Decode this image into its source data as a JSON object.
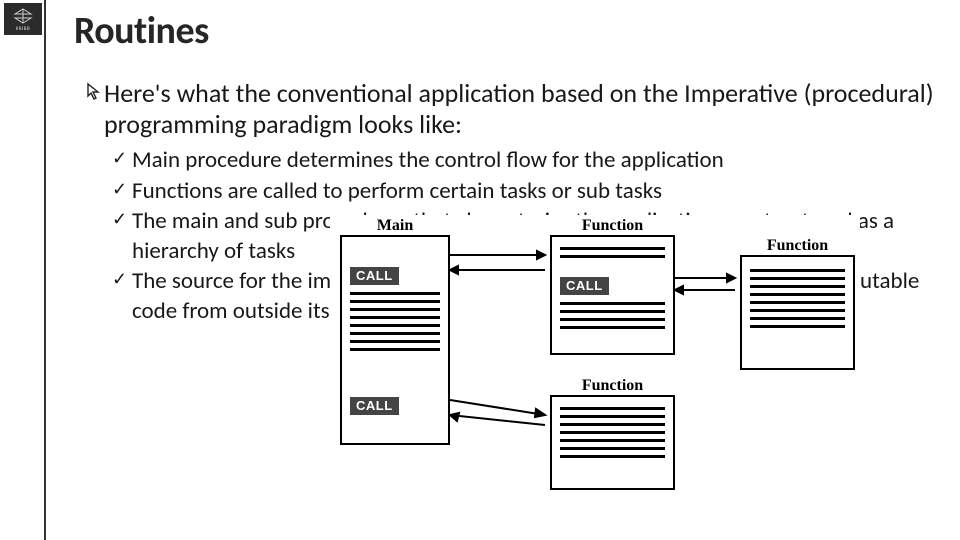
{
  "logo": {
    "caption": "KRIBB"
  },
  "title": "Routines",
  "intro": {
    "text": "Here's what the conventional application based on the Imperative (procedural) programming paradigm looks like:"
  },
  "bullets": [
    "Main procedure determines the control flow for the application",
    "Functions are called to perform certain tasks or sub tasks",
    "The main and sub procedures that characterize the application are structured as a hierarchy of tasks",
    "The source for the imperative application does not include any additional executable code from outside itself"
  ],
  "diagram": {
    "main_label": "Main",
    "function_label": "Function",
    "call_label": "CALL"
  }
}
